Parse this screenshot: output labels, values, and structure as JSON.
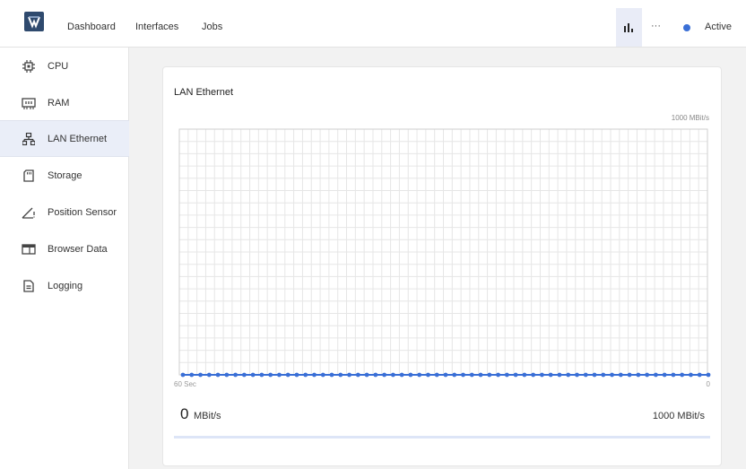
{
  "topbar": {
    "nav": [
      "Dashboard",
      "Interfaces",
      "Jobs"
    ],
    "more_label": "···",
    "status_label": "Active",
    "status_color": "#3a6fd6"
  },
  "sidebar": {
    "items": [
      {
        "label": "CPU",
        "icon": "cpu-icon"
      },
      {
        "label": "RAM",
        "icon": "ram-icon"
      },
      {
        "label": "LAN Ethernet",
        "icon": "network-icon",
        "active": true
      },
      {
        "label": "Storage",
        "icon": "sd-card-icon"
      },
      {
        "label": "Position Sensor",
        "icon": "angle-icon"
      },
      {
        "label": "Browser Data",
        "icon": "browser-window-icon"
      },
      {
        "label": "Logging",
        "icon": "document-icon"
      }
    ]
  },
  "main": {
    "title": "LAN Ethernet",
    "max_label": "1000 MBit/s",
    "x_left_label": "60 Sec",
    "x_right_label": "0",
    "current_value": "0",
    "current_unit": "MBit/s",
    "max_value_label": "1000 MBit/s",
    "progress": 0
  },
  "chart_data": {
    "type": "line",
    "title": "LAN Ethernet",
    "xlim": [
      60,
      0
    ],
    "ylim": [
      0,
      1000
    ],
    "ytick_label": "1000 MBit/s",
    "x_tick_labels": [
      "60 Sec",
      "0"
    ],
    "grid": true,
    "series": [
      {
        "color": "#3a6fd6",
        "values": [
          0,
          0,
          0,
          0,
          0,
          0,
          0,
          0,
          0,
          0,
          0,
          0,
          0,
          0,
          0,
          0,
          0,
          0,
          0,
          0,
          0,
          0,
          0,
          0,
          0,
          0,
          0,
          0,
          0,
          0,
          0,
          0,
          0,
          0,
          0,
          0,
          0,
          0,
          0,
          0,
          0,
          0,
          0,
          0,
          0,
          0,
          0,
          0,
          0,
          0,
          0,
          0,
          0,
          0,
          0,
          0,
          0,
          0,
          0,
          0,
          0
        ]
      }
    ]
  }
}
